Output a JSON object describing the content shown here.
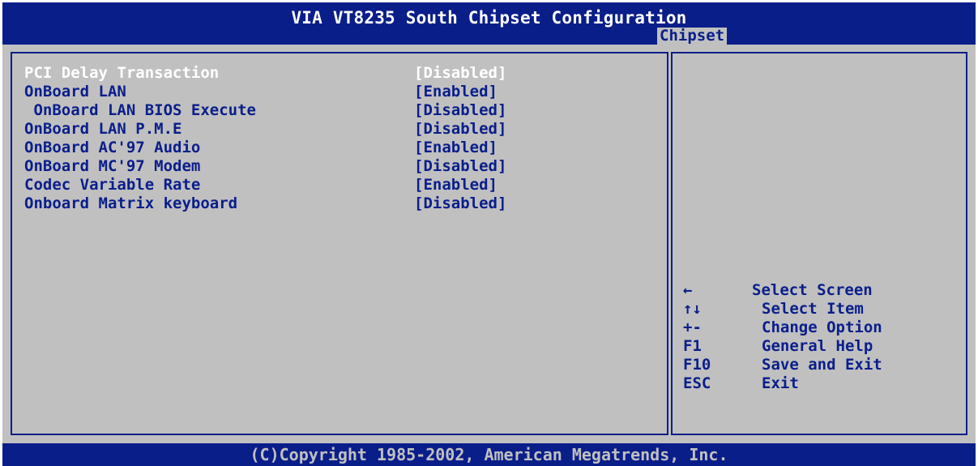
{
  "header": {
    "title": "VIA VT8235 South Chipset Configuration",
    "active_tab": "Chipset"
  },
  "settings": [
    {
      "label": "PCI Delay Transaction",
      "value": "[Disabled]",
      "selected": true
    },
    {
      "label": "OnBoard LAN",
      "value": "[Enabled]"
    },
    {
      "label": " OnBoard LAN BIOS Execute",
      "value": "[Disabled]"
    },
    {
      "label": "OnBoard LAN P.M.E",
      "value": "[Disabled]"
    },
    {
      "label": "OnBoard AC'97 Audio",
      "value": "[Enabled]"
    },
    {
      "label": "OnBoard MC'97 Modem",
      "value": "[Disabled]"
    },
    {
      "label": "Codec Variable Rate",
      "value": "[Enabled]"
    },
    {
      "label": "Onboard Matrix keyboard",
      "value": "[Disabled]"
    }
  ],
  "help": [
    {
      "key": "←",
      "desc": "Select Screen"
    },
    {
      "key": "↑↓",
      "desc": "Select Item"
    },
    {
      "key": "+-",
      "desc": "Change Option"
    },
    {
      "key": "F1",
      "desc": "General Help"
    },
    {
      "key": "F10",
      "desc": "Save and Exit"
    },
    {
      "key": "ESC",
      "desc": "Exit"
    }
  ],
  "footer": {
    "copyright": "(C)Copyright 1985-2002, American Megatrends, Inc."
  },
  "colors": {
    "bios_blue": "#0a1e8a",
    "panel_gray": "#c0c0c0",
    "selected_text": "#ffffff"
  }
}
